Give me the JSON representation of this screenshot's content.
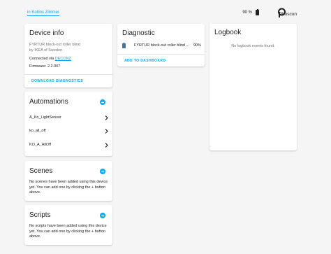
{
  "header": {
    "area_link": "in Kollins Zimmer",
    "battery_percent": "90 %",
    "brand": "Phoscon"
  },
  "device_info": {
    "title": "Device info",
    "model": "FYRTUR block-out roller blind",
    "manufacturer": "by IKEA of Sweden",
    "connected_prefix": "Connected via ",
    "connected_link": "DECONZ",
    "firmware": "Firmware: 2.2.007",
    "action": "DOWNLOAD DIAGNOSTICS"
  },
  "automations": {
    "title": "Automations",
    "items": [
      {
        "label": "A_Ko_LightSensor"
      },
      {
        "label": "ko_all_off"
      },
      {
        "label": "KO_A_AllOff"
      }
    ]
  },
  "scenes": {
    "title": "Scenes",
    "empty_text": "No scenes have been added using this device yet. You can add one by clicking the + button above."
  },
  "scripts": {
    "title": "Scripts",
    "empty_text": "No scripts have been added using this device yet. You can add one by clicking the + button above."
  },
  "diagnostic": {
    "title": "Diagnostic",
    "entity_name": "FYRTUR block-out roller blind ...",
    "entity_value": "90%",
    "action": "ADD TO DASHBOARD"
  },
  "logbook": {
    "title": "Logbook",
    "empty_text": "No logbook events found."
  },
  "colors": {
    "accent": "#03a9f4",
    "background": "#f5f5f5",
    "card": "#ffffff"
  }
}
